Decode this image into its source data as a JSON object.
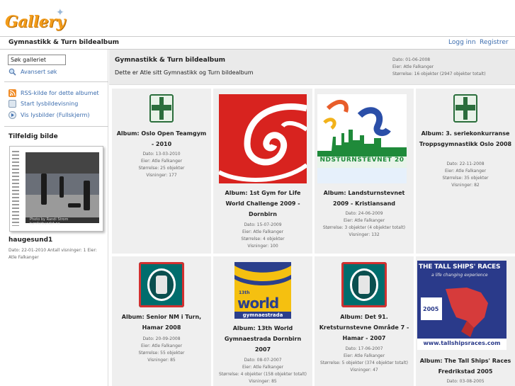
{
  "header": {
    "logo_text": "Gallery",
    "breadcrumb": "Gymnastikk & Turn bildealbum",
    "login": "Logg inn",
    "register": "Registrer"
  },
  "sidebar": {
    "search_value": "Søk galleriet",
    "advanced_search": "Avansert søk",
    "rss": "RSS-kilde for dette albumet",
    "slideshow": "Start lysbildevisning",
    "fullscreen": "Vis lysbilder (Fullskjerm)",
    "random_heading": "Tilfeldig bilde",
    "random_caption": "Photo by Randi Strom   turnforbundet.no",
    "random_title": "haugesund1",
    "random_meta": "Dato: 22-01-2010 Antall visninger: 1 Eier: Atle Falkanger"
  },
  "album": {
    "title": "Gymnastikk & Turn bildealbum",
    "description": "Dette er Atle sitt Gymnastikk og Turn bildealbum",
    "date": "Dato: 01-06-2008",
    "owner": "Eier: Atle Falkanger",
    "size": "Størrelse: 16 objekter (2947 objekter totalt)"
  },
  "items": [
    {
      "caption": "Album: Oslo Open Teamgym - 2010",
      "date": "Dato: 13-03-2010",
      "owner": "Eier: Atle Falkanger",
      "size": "Størrelse: 25 objekter",
      "views": "Visninger: 177",
      "thumb_kind": "green-badge"
    },
    {
      "caption": "Album: 1st Gym for Life World Challenge 2009 - Dornbirn",
      "date": "Dato: 15-07-2009",
      "owner": "Eier: Atle Falkanger",
      "size": "Størrelse: 4 objekter",
      "views": "Visninger: 100",
      "thumb_kind": "red-spiral"
    },
    {
      "caption": "Album: Landsturnstevnet 2009 - Kristiansand",
      "date": "Dato: 24-06-2009",
      "owner": "Eier: Atle Falkanger",
      "size": "Størrelse: 3 objekter (4 objekter totalt)",
      "views": "Visninger: 132",
      "thumb_kind": "landsturnstevnet",
      "thumb_text": "NDSTURNSTEVNET 20"
    },
    {
      "caption": "Album: 3. seriekonkurranse Troppsgymnastikk Oslo 2008",
      "date": "Dato: 22-11-2008",
      "owner": "Eier: Atle Falkanger",
      "size": "Størrelse: 35 objekter",
      "views": "Visninger: 82",
      "thumb_kind": "green-badge"
    },
    {
      "caption": "Album: Senior NM i Turn, Hamar 2008",
      "date": "Dato: 20-09-2008",
      "owner": "Eier: Atle Falkanger",
      "size": "Størrelse: 55 objekter",
      "views": "Visninger: 85",
      "thumb_kind": "teal-badge"
    },
    {
      "caption": "Album: 13th World Gymnaestrada Dornbirn 2007",
      "date": "Dato: 08-07-2007",
      "owner": "Eier: Atle Falkanger",
      "size": "Størrelse: 4 objekter (158 objekter totalt)",
      "views": "Visninger: 85",
      "thumb_kind": "world",
      "thumb_text_small": "13th",
      "thumb_text_big": "world",
      "thumb_text_sub": "gymnaestrada"
    },
    {
      "caption": "Album: Det 91. Kretsturnstevne Område 7 - Hamar - 2007",
      "date": "Dato: 17-06-2007",
      "owner": "Eier: Atle Falkanger",
      "size": "Størrelse: 5 objekter (374 objekter totalt)",
      "views": "Visninger: 47",
      "thumb_kind": "teal-badge"
    },
    {
      "caption": "Album: The Tall Ships' Races Fredrikstad 2005",
      "date": "Dato: 03-08-2005",
      "owner": "",
      "size": "",
      "views": "",
      "thumb_kind": "tallships",
      "thumb_text": "THE TALL SHIPS' RACES",
      "thumb_sub": "a life changing experience",
      "thumb_year": "2005",
      "thumb_url": "www.tallshipsraces.com"
    }
  ]
}
